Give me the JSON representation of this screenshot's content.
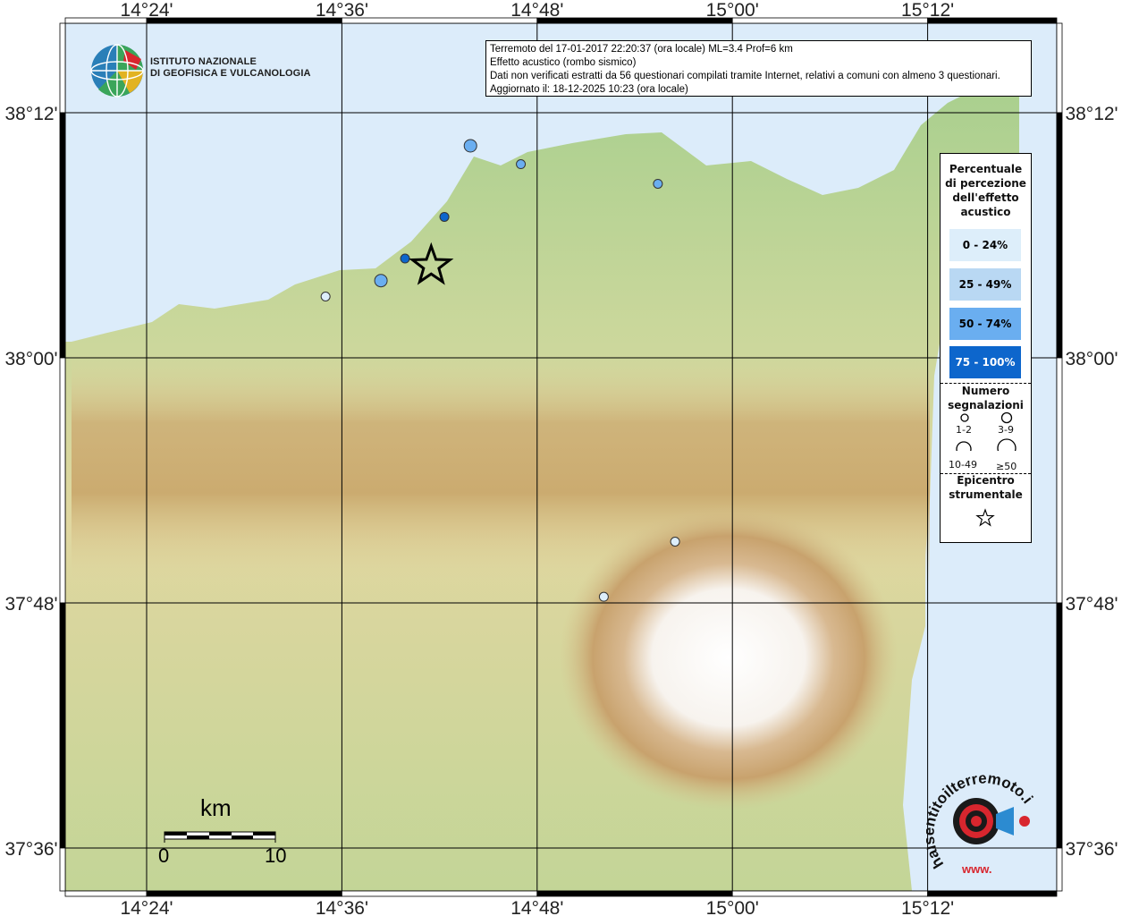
{
  "map": {
    "title_lines": [
      "Terremoto del 17-01-2017 22:20:37 (ora locale) ML=3.4 Prof=6 km",
      "Effetto acustico (rombo sismico)",
      "Dati non verificati estratti da 56 questionari compilati tramite Internet, relativi a comuni con almeno 3 questionari.",
      "Aggiornato il: 18-12-2025 10:23 (ora locale)"
    ],
    "lon_ticks": [
      "14°24'",
      "14°36'",
      "14°48'",
      "15°00'",
      "15°12'"
    ],
    "lat_ticks": [
      "38°12'",
      "38°00'",
      "37°48'",
      "37°36'"
    ],
    "colors": {
      "sea": "#dcecfa",
      "land_low": "#a8cf8e",
      "land_mid": "#e3d9a4",
      "land_high": "#c9a66a",
      "peak": "#ffffff",
      "class_0_24": "#ddeefa",
      "class_25_49": "#b9d8f3",
      "class_50_74": "#6aaef0",
      "class_75_100": "#0d66cc"
    }
  },
  "logo": {
    "line1": "ISTITUTO NAZIONALE",
    "line2": "DI GEOFISICA E VULCANOLOGIA"
  },
  "legend": {
    "perc_title": "Percentuale di percezione dell'effetto acustico",
    "perc_title_lines": [
      "Percentuale",
      "di percezione",
      "dell'effetto",
      "acustico"
    ],
    "classes": [
      "0 - 24%",
      "25 - 49%",
      "50 - 74%",
      "75 - 100%"
    ],
    "count_title_lines": [
      "Numero",
      "segnalazioni"
    ],
    "counts": [
      "1-2",
      "3-9",
      "10-49",
      "≥50"
    ],
    "epi_title_lines": [
      "Epicentro",
      "strumentale"
    ]
  },
  "scale": {
    "unit": "km",
    "start": "0",
    "end": "10"
  },
  "brand": {
    "text": "haisentitoilterremoto.it",
    "www": "www."
  },
  "points": [
    {
      "lon": 14.7317,
      "lat": 38.173,
      "cls": 2,
      "size": 2
    },
    {
      "lon": 14.7833,
      "lat": 38.158,
      "cls": 2,
      "size": 1
    },
    {
      "lon": 14.9237,
      "lat": 38.142,
      "cls": 2,
      "size": 1
    },
    {
      "lon": 14.705,
      "lat": 38.115,
      "cls": 3,
      "size": 1
    },
    {
      "lon": 14.6647,
      "lat": 38.081,
      "cls": 3,
      "size": 1
    },
    {
      "lon": 14.64,
      "lat": 38.063,
      "cls": 2,
      "size": 2
    },
    {
      "lon": 14.5833,
      "lat": 38.05,
      "cls": 0,
      "size": 1
    },
    {
      "lon": 14.8683,
      "lat": 37.805,
      "cls": 0,
      "size": 1
    },
    {
      "lon": 14.9413,
      "lat": 37.85,
      "cls": 0,
      "size": 1
    }
  ],
  "epicenter": {
    "lon": 14.6915,
    "lat": 38.075
  }
}
